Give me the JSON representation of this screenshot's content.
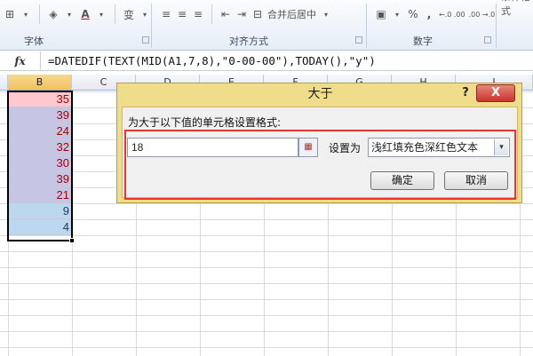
{
  "ribbon": {
    "groups": [
      {
        "label": "字体"
      },
      {
        "label": "对齐方式"
      },
      {
        "label": "数字"
      }
    ],
    "font_color_glyph": "A",
    "merge_label": "合并后居中",
    "percent_glyph": "%",
    "comma_glyph": ",",
    "increase_decimal": "←.0 .00",
    "decrease_decimal": ".00 →.0",
    "wen_glyph": "变",
    "conditional_format_label": "条件格式"
  },
  "formula_bar": {
    "fx_label": "fx",
    "formula": "=DATEDIF(TEXT(MID(A1,7,8),\"0-00-00\"),TODAY(),\"y\")"
  },
  "columns": [
    "B",
    "C",
    "D",
    "E",
    "F",
    "G",
    "H",
    "I"
  ],
  "cells": [
    {
      "value": "35",
      "fill": "red"
    },
    {
      "value": "39",
      "fill": "purple"
    },
    {
      "value": "24",
      "fill": "purple"
    },
    {
      "value": "32",
      "fill": "purple"
    },
    {
      "value": "30",
      "fill": "purple"
    },
    {
      "value": "39",
      "fill": "purple"
    },
    {
      "value": "21",
      "fill": "purple"
    },
    {
      "value": "9",
      "fill": "blue"
    },
    {
      "value": "4",
      "fill": "blue"
    }
  ],
  "dialog": {
    "title": "大于",
    "help_glyph": "?",
    "close_glyph": "X",
    "prompt": "为大于以下值的单元格设置格式:",
    "value": "18",
    "set_label": "设置为",
    "format_option": "浅红填充色深红色文本",
    "ok_label": "确定",
    "cancel_label": "取消"
  },
  "colors": {
    "highlight_red": "#e8352f",
    "title_bar": "#f0dd8b",
    "close_button": "#c8352b"
  }
}
